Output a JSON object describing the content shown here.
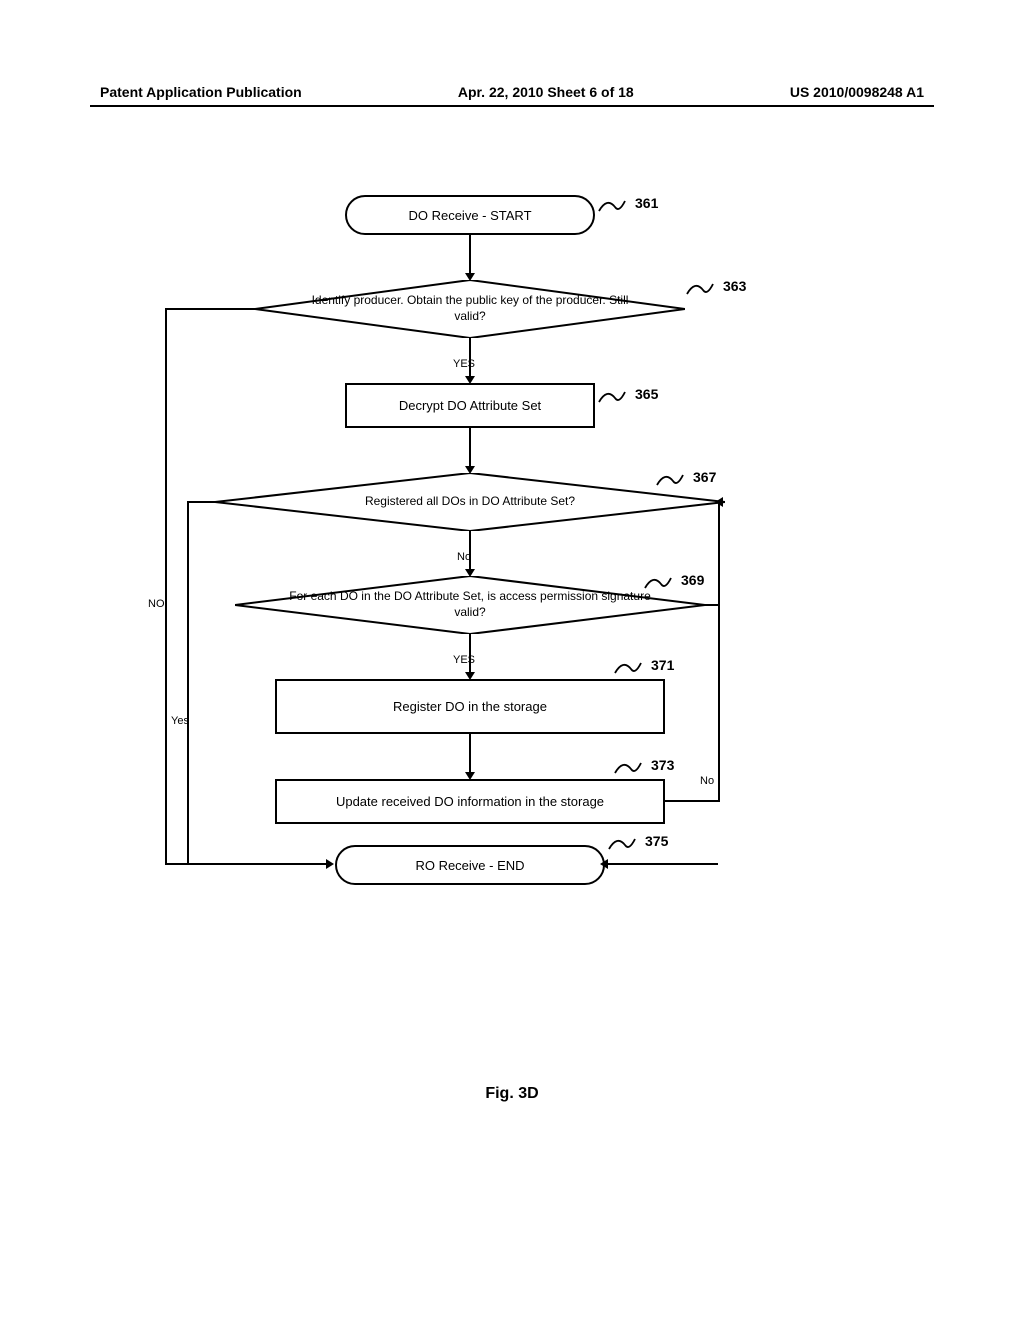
{
  "header": {
    "left": "Patent Application Publication",
    "center": "Apr. 22, 2010  Sheet 6 of 18",
    "right": "US 2010/0098248 A1"
  },
  "nodes": {
    "n361": {
      "text": "DO Receive - START",
      "ref": "361"
    },
    "n363": {
      "text": "Identify producer. Obtain the public key of the producer. Still valid?",
      "ref": "363"
    },
    "n365": {
      "text": "Decrypt DO Attribute Set",
      "ref": "365"
    },
    "n367": {
      "text": "Registered all DOs in DO Attribute Set?",
      "ref": "367"
    },
    "n369": {
      "text": "For each DO in the DO Attribute Set, is access permission signature valid?",
      "ref": "369"
    },
    "n371": {
      "text": "Register DO in the storage",
      "ref": "371"
    },
    "n373": {
      "text": "Update received DO information in the storage",
      "ref": "373"
    },
    "n375": {
      "text": "RO Receive - END",
      "ref": "375"
    }
  },
  "edges": {
    "e363_yes": "YES",
    "e367_no": "No",
    "e369_yes": "YES",
    "e363_no": "NO",
    "e367_yes": "Yes",
    "e369_no": "No"
  },
  "figure_caption": "Fig. 3D"
}
